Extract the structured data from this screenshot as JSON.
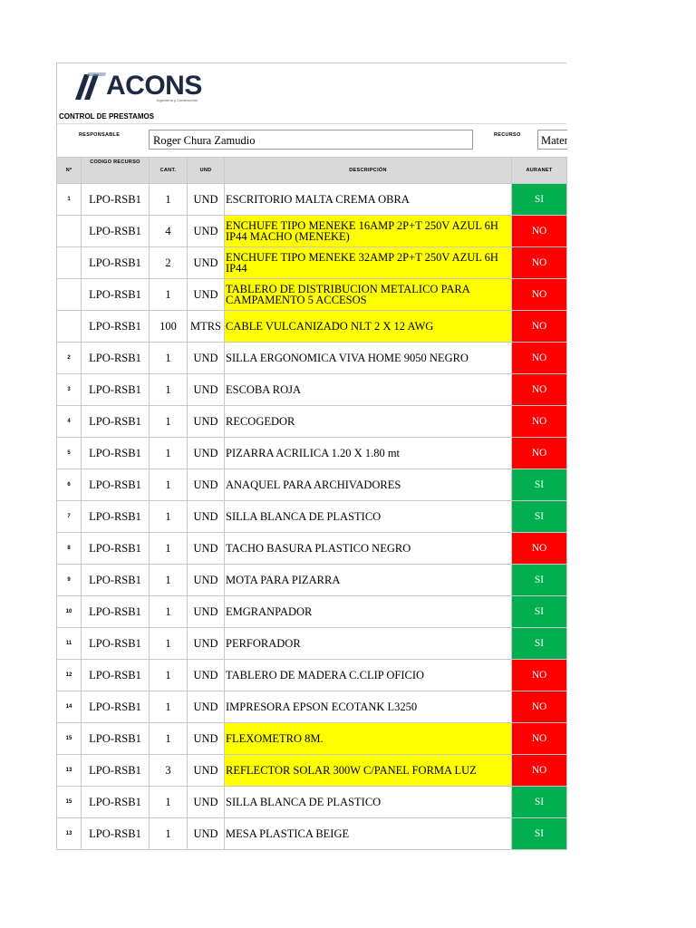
{
  "brand": {
    "name": "ACONS",
    "tagline": "Ingeniería y Construcción",
    "logo_color": "#1c2a44"
  },
  "header": {
    "section_title": "CONTROL DE PRESTAMOS",
    "responsable_label": "RESPONSABLE",
    "responsable_value": "Roger Chura Zamudio",
    "recurso_label": "RECURSO",
    "recurso_value": "Mater"
  },
  "columns": [
    "Nº",
    "CODIGO RECURSO",
    "CANT.",
    "UND",
    "DESCRIPCIÓN",
    "AURANET"
  ],
  "status_colors": {
    "SI": "#00b050",
    "NO": "#ff0000",
    "highlight": "#ffff00"
  },
  "rows": [
    {
      "n": "1",
      "code": "LPO-RSB1",
      "qty": "1",
      "und": "UND",
      "desc": "ESCRITORIO MALTA CREMA OBRA",
      "highlight": false,
      "status": "SI"
    },
    {
      "n": "",
      "code": "LPO-RSB1",
      "qty": "4",
      "und": "UND",
      "desc": "ENCHUFE TIPO MENEKE 16AMP 2P+T 250V AZUL 6H IP44 MACHO (MENEKE)",
      "highlight": true,
      "status": "NO"
    },
    {
      "n": "",
      "code": "LPO-RSB1",
      "qty": "2",
      "und": "UND",
      "desc": "ENCHUFE TIPO MENEKE 32AMP 2P+T  250V AZUL 6H IP44",
      "highlight": true,
      "status": "NO"
    },
    {
      "n": "",
      "code": "LPO-RSB1",
      "qty": "1",
      "und": "UND",
      "desc": "TABLERO DE DISTRIBUCION METALICO PARA CAMPAMENTO 5 ACCESOS",
      "highlight": true,
      "status": "NO"
    },
    {
      "n": "",
      "code": "LPO-RSB1",
      "qty": "100",
      "und": "MTRS",
      "desc": "CABLE VULCANIZADO NLT 2 X 12 AWG",
      "highlight": true,
      "status": "NO"
    },
    {
      "n": "2",
      "code": "LPO-RSB1",
      "qty": "1",
      "und": "UND",
      "desc": "SILLA ERGONOMICA VIVA HOME 9050 NEGRO",
      "highlight": false,
      "status": "NO"
    },
    {
      "n": "3",
      "code": "LPO-RSB1",
      "qty": "1",
      "und": "UND",
      "desc": "ESCOBA ROJA",
      "highlight": false,
      "status": "NO"
    },
    {
      "n": "4",
      "code": "LPO-RSB1",
      "qty": "1",
      "und": "UND",
      "desc": "RECOGEDOR",
      "highlight": false,
      "status": "NO"
    },
    {
      "n": "5",
      "code": "LPO-RSB1",
      "qty": "1",
      "und": "UND",
      "desc": "PIZARRA ACRILICA 1.20 X 1.80 mt",
      "highlight": false,
      "status": "NO"
    },
    {
      "n": "6",
      "code": "LPO-RSB1",
      "qty": "1",
      "und": "UND",
      "desc": "ANAQUEL PARA ARCHIVADORES",
      "highlight": false,
      "status": "SI"
    },
    {
      "n": "7",
      "code": "LPO-RSB1",
      "qty": "1",
      "und": "UND",
      "desc": "SILLA BLANCA DE PLASTICO",
      "highlight": false,
      "status": "SI"
    },
    {
      "n": "8",
      "code": "LPO-RSB1",
      "qty": "1",
      "und": "UND",
      "desc": "TACHO BASURA PLASTICO NEGRO",
      "highlight": false,
      "status": "NO"
    },
    {
      "n": "9",
      "code": "LPO-RSB1",
      "qty": "1",
      "und": "UND",
      "desc": "MOTA PARA PIZARRA",
      "highlight": false,
      "status": "SI"
    },
    {
      "n": "10",
      "code": "LPO-RSB1",
      "qty": "1",
      "und": "UND",
      "desc": "EMGRANPADOR",
      "highlight": false,
      "status": "SI"
    },
    {
      "n": "11",
      "code": "LPO-RSB1",
      "qty": "1",
      "und": "UND",
      "desc": "PERFORADOR",
      "highlight": false,
      "status": "SI"
    },
    {
      "n": "12",
      "code": "LPO-RSB1",
      "qty": "1",
      "und": "UND",
      "desc": "TABLERO DE MADERA C.CLIP OFICIO",
      "highlight": false,
      "status": "NO"
    },
    {
      "n": "14",
      "code": "LPO-RSB1",
      "qty": "1",
      "und": "UND",
      "desc": "IMPRESORA EPSON ECOTANK L3250",
      "highlight": false,
      "status": "NO"
    },
    {
      "n": "15",
      "code": "LPO-RSB1",
      "qty": "1",
      "und": "UND",
      "desc": "FLEXOMETRO 8M.",
      "highlight": true,
      "status": "NO"
    },
    {
      "n": "13",
      "code": "LPO-RSB1",
      "qty": "3",
      "und": "UND",
      "desc": "REFLECTOR SOLAR 300W C/PANEL FORMA LUZ",
      "highlight": true,
      "status": "NO"
    },
    {
      "n": "15",
      "code": "LPO-RSB1",
      "qty": "1",
      "und": "UND",
      "desc": "SILLA BLANCA DE PLASTICO",
      "highlight": false,
      "status": "SI"
    },
    {
      "n": "13",
      "code": "LPO-RSB1",
      "qty": "1",
      "und": "UND",
      "desc": "MESA PLASTICA BEIGE",
      "highlight": false,
      "status": "SI"
    }
  ]
}
